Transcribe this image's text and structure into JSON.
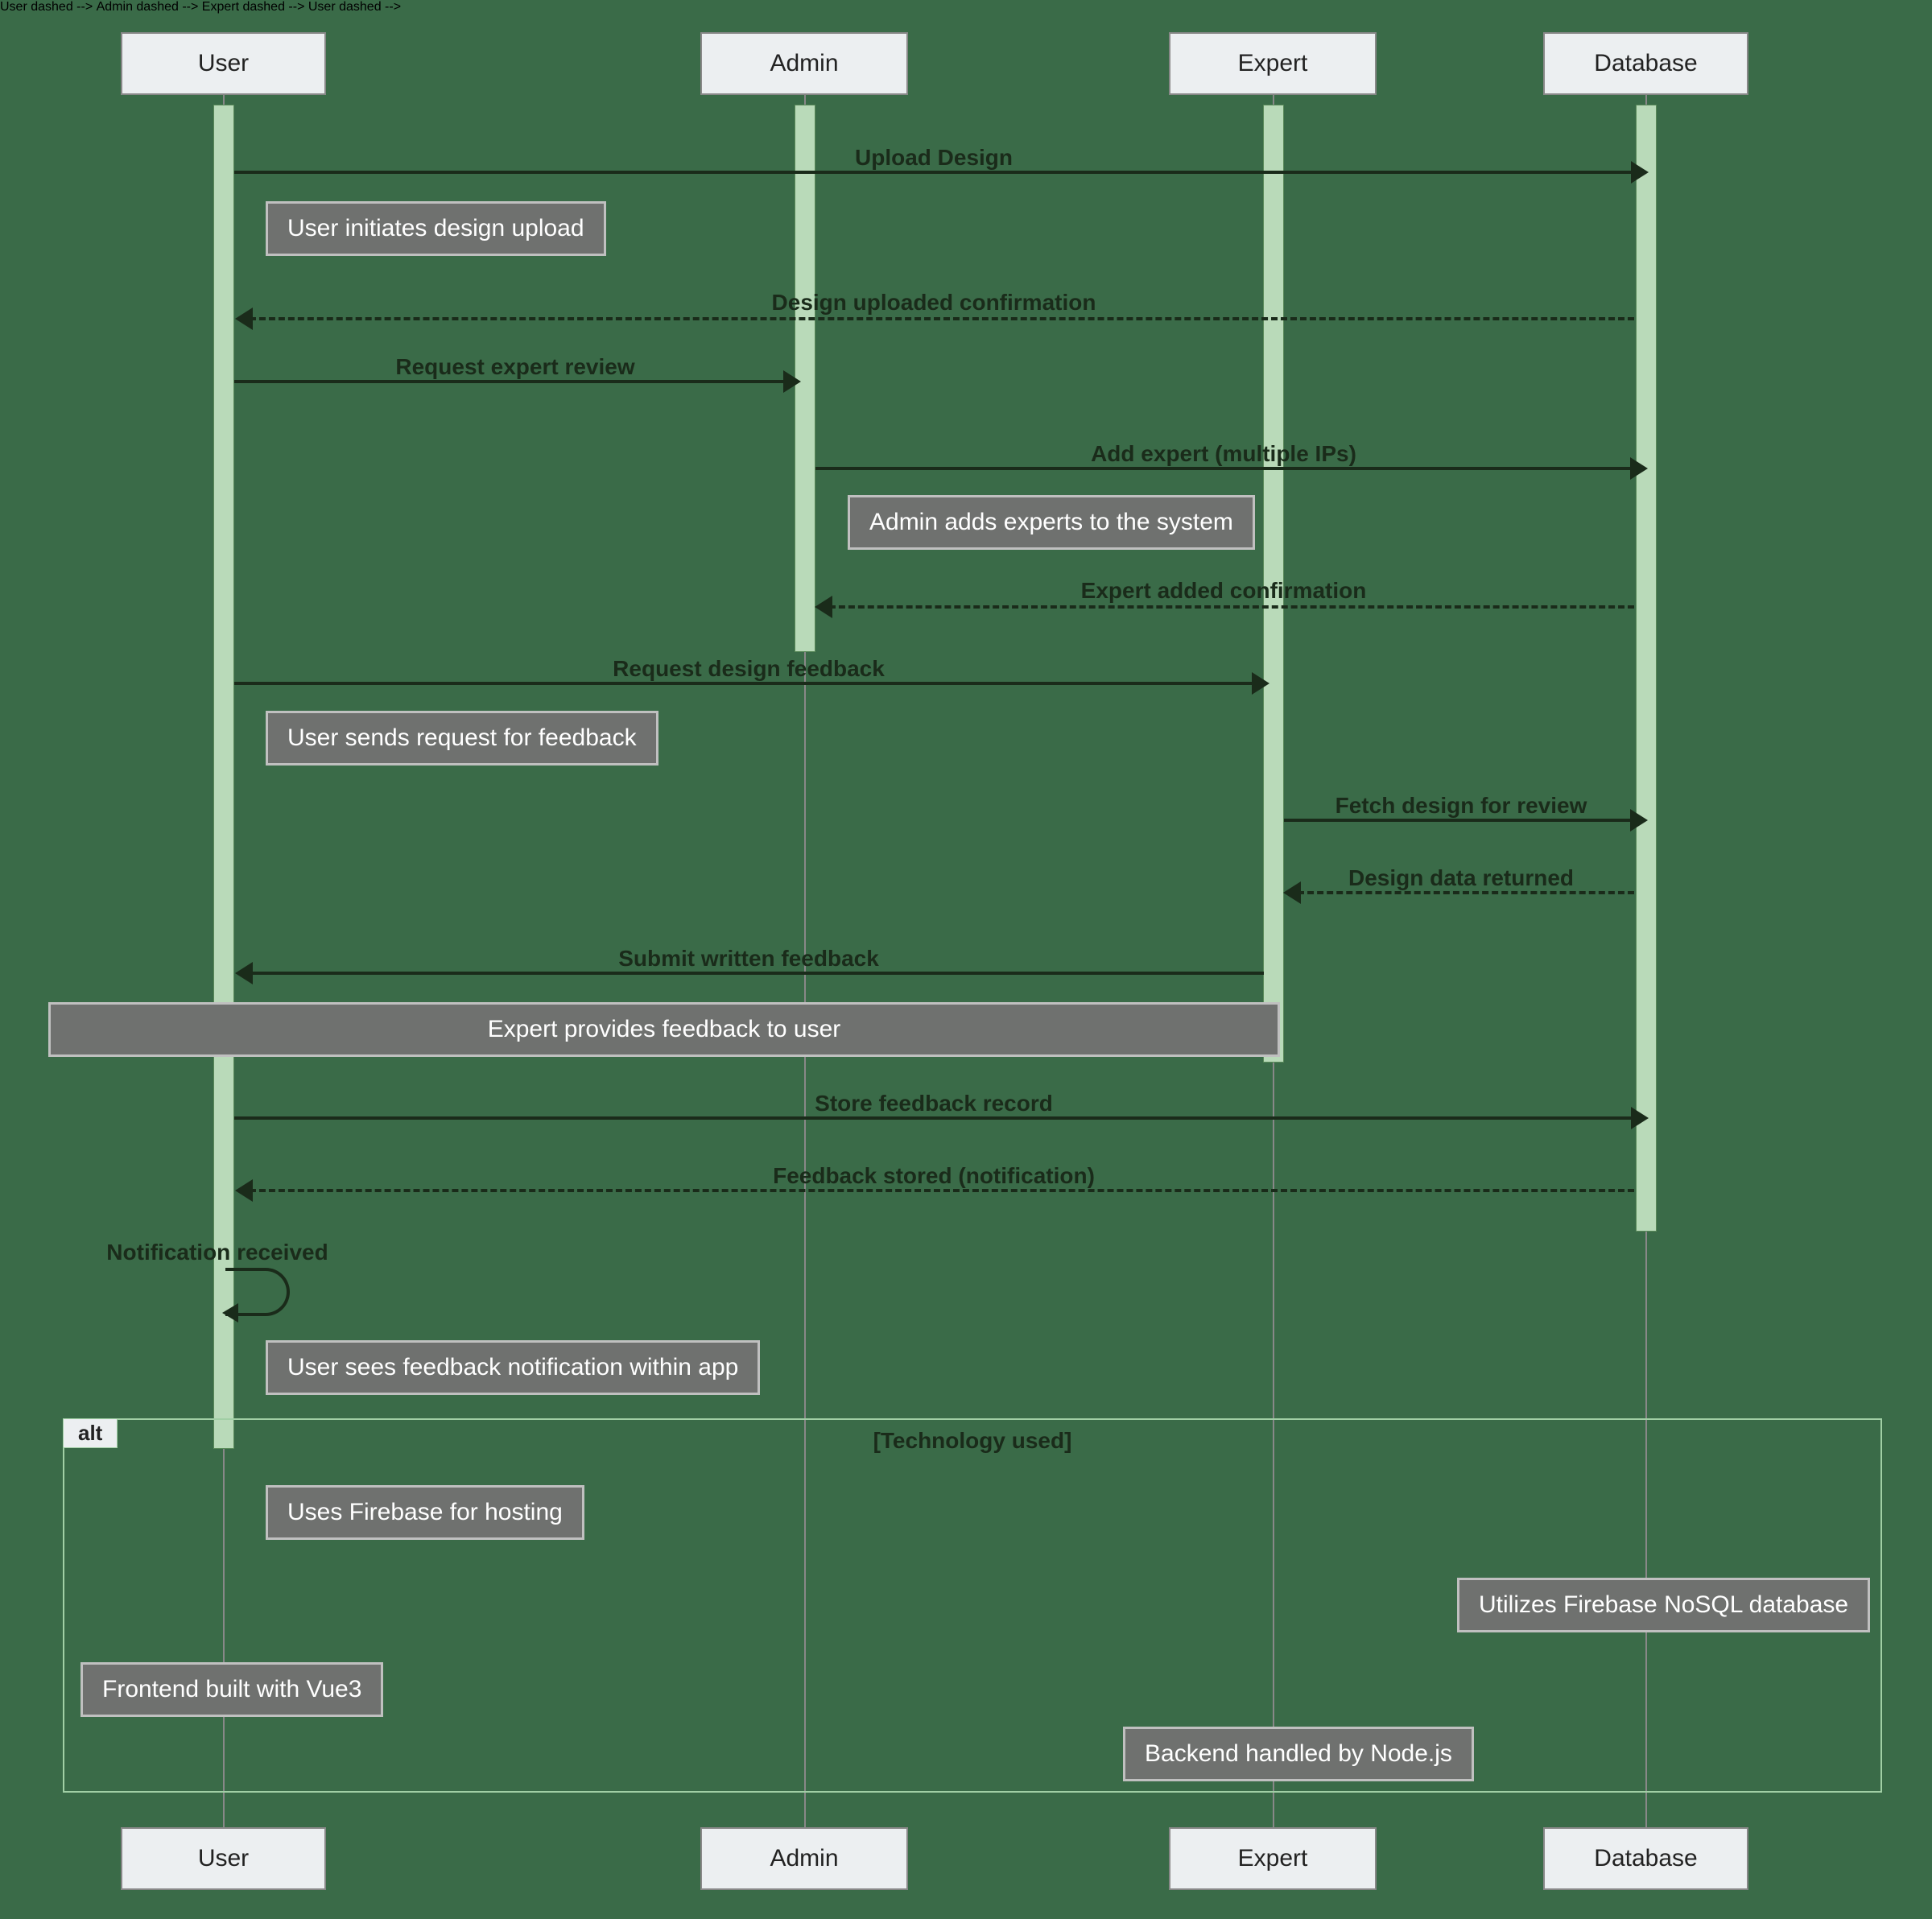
{
  "chart_data": {
    "type": "sequence_diagram",
    "actors": [
      "User",
      "Admin",
      "Expert",
      "Database"
    ],
    "messages": [
      {
        "from": "User",
        "to": "Database",
        "label": "Upload Design",
        "style": "solid"
      },
      {
        "note": "User initiates design upload",
        "over": "User"
      },
      {
        "from": "Database",
        "to": "User",
        "label": "Design uploaded confirmation",
        "style": "dashed"
      },
      {
        "from": "User",
        "to": "Admin",
        "label": "Request expert review",
        "style": "solid"
      },
      {
        "from": "Admin",
        "to": "Database",
        "label": "Add expert (multiple IPs)",
        "style": "solid"
      },
      {
        "note": "Admin adds experts to the system",
        "over": "Admin"
      },
      {
        "from": "Database",
        "to": "Admin",
        "label": "Expert added confirmation",
        "style": "dashed"
      },
      {
        "from": "User",
        "to": "Expert",
        "label": "Request design feedback",
        "style": "solid"
      },
      {
        "note": "User sends request for feedback",
        "over": "User"
      },
      {
        "from": "Expert",
        "to": "Database",
        "label": "Fetch design for review",
        "style": "solid"
      },
      {
        "from": "Database",
        "to": "Expert",
        "label": "Design data returned",
        "style": "dashed"
      },
      {
        "from": "Expert",
        "to": "User",
        "label": "Submit written feedback",
        "style": "solid"
      },
      {
        "note": "Expert provides feedback to user",
        "over": [
          "User",
          "Admin",
          "Expert"
        ]
      },
      {
        "from": "User",
        "to": "Database",
        "label": "Store feedback record",
        "style": "solid"
      },
      {
        "from": "Database",
        "to": "User",
        "label": "Feedback stored (notification)",
        "style": "dashed"
      },
      {
        "from": "User",
        "to": "User",
        "label": "Notification received",
        "style": "self"
      },
      {
        "note": "User sees feedback notification within app",
        "over": "User"
      }
    ],
    "alt": {
      "label": "alt",
      "title": "[Technology used]",
      "notes": [
        {
          "text": "Uses Firebase for hosting",
          "over": "User"
        },
        {
          "text": "Utilizes Firebase NoSQL database",
          "over": "Database"
        },
        {
          "text": "Frontend built with Vue3",
          "over": "User",
          "side": "left"
        },
        {
          "text": "Backend handled by Node.js",
          "over": "Expert"
        }
      ]
    }
  },
  "actors": {
    "user": "User",
    "admin": "Admin",
    "expert": "Expert",
    "database": "Database"
  },
  "messages": {
    "m1": "Upload Design",
    "m2": "Design uploaded confirmation",
    "m3": "Request expert review",
    "m4": "Add expert (multiple IPs)",
    "m5": "Expert added confirmation",
    "m6": "Request design feedback",
    "m7": "Fetch design for review",
    "m8": "Design data returned",
    "m9": "Submit written feedback",
    "m10": "Store feedback record",
    "m11": "Feedback stored (notification)",
    "m12": "Notification received"
  },
  "notes": {
    "n1": "User initiates design upload",
    "n2": "Admin adds experts to the system",
    "n3": "User sends request for feedback",
    "n4": "Expert provides feedback to user",
    "n5": "User sees feedback notification within app",
    "nA": "Uses Firebase for hosting",
    "nB": "Utilizes Firebase NoSQL database",
    "nC": "Frontend built with Vue3",
    "nD": "Backend handled by Node.js"
  },
  "alt": {
    "label": "alt",
    "title": "[Technology used]"
  }
}
